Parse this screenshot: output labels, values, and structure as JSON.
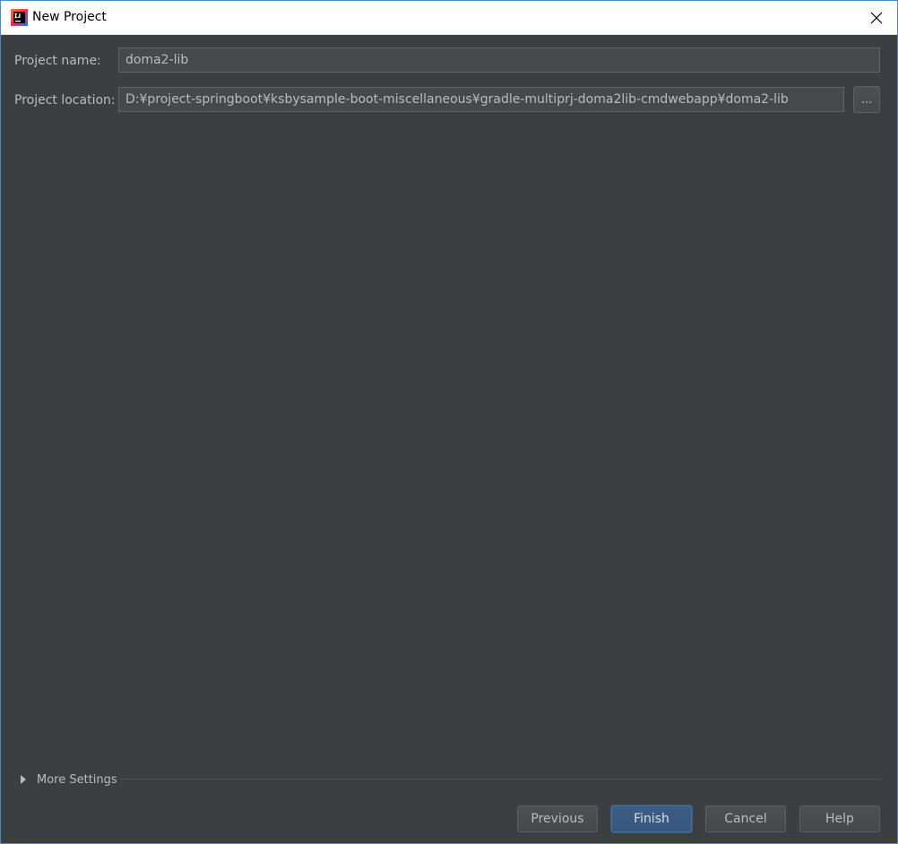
{
  "window": {
    "title": "New Project",
    "icon": "intellij-idea-icon",
    "close_icon": "close-icon"
  },
  "form": {
    "project_name_label": "Project name:",
    "project_name_value": "doma2-lib",
    "project_location_label": "Project location:",
    "project_location_value": "D:¥project-springboot¥ksbysample-boot-miscellaneous¥gradle-multiprj-doma2lib-cmdwebapp¥doma2-lib",
    "browse_label": "..."
  },
  "more_settings": {
    "label": "More Settings",
    "expanded": false
  },
  "buttons": {
    "previous": "Previous",
    "finish": "Finish",
    "cancel": "Cancel",
    "help": "Help"
  },
  "colors": {
    "background": "#3c3f41",
    "field_background": "#45494a",
    "text": "#bbbbbb",
    "primary_button": "#365880",
    "window_border": "#4a88c7"
  }
}
